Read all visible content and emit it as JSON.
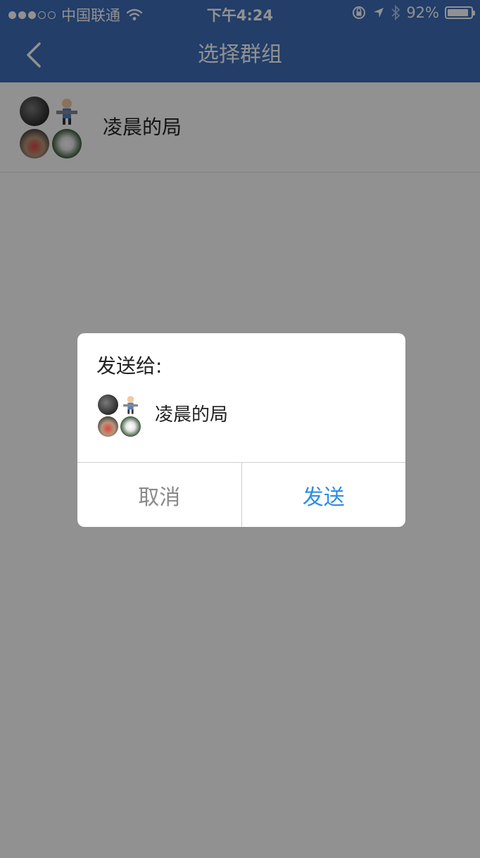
{
  "status_bar": {
    "carrier": "中国联通",
    "time": "下午4:24",
    "battery": "92%",
    "battery_level": 0.92,
    "signal_bars_filled": 3,
    "signal_bars_total": 5,
    "icons": [
      "wifi-icon",
      "orientation-lock-icon",
      "location-icon",
      "bluetooth-icon",
      "battery-icon"
    ]
  },
  "nav": {
    "title": "选择群组",
    "back_icon": "chevron-left-icon"
  },
  "list": {
    "items": [
      {
        "name": "凌晨的局"
      }
    ]
  },
  "dialog": {
    "title": "发送给:",
    "recipient_name": "凌晨的局",
    "cancel_label": "取消",
    "send_label": "发送"
  },
  "colors": {
    "nav_background": "#3d6eb9",
    "send_button": "#2f8de4",
    "cancel_button": "#8a8a8a",
    "overlay": "rgba(0,0,0,0.43)"
  }
}
